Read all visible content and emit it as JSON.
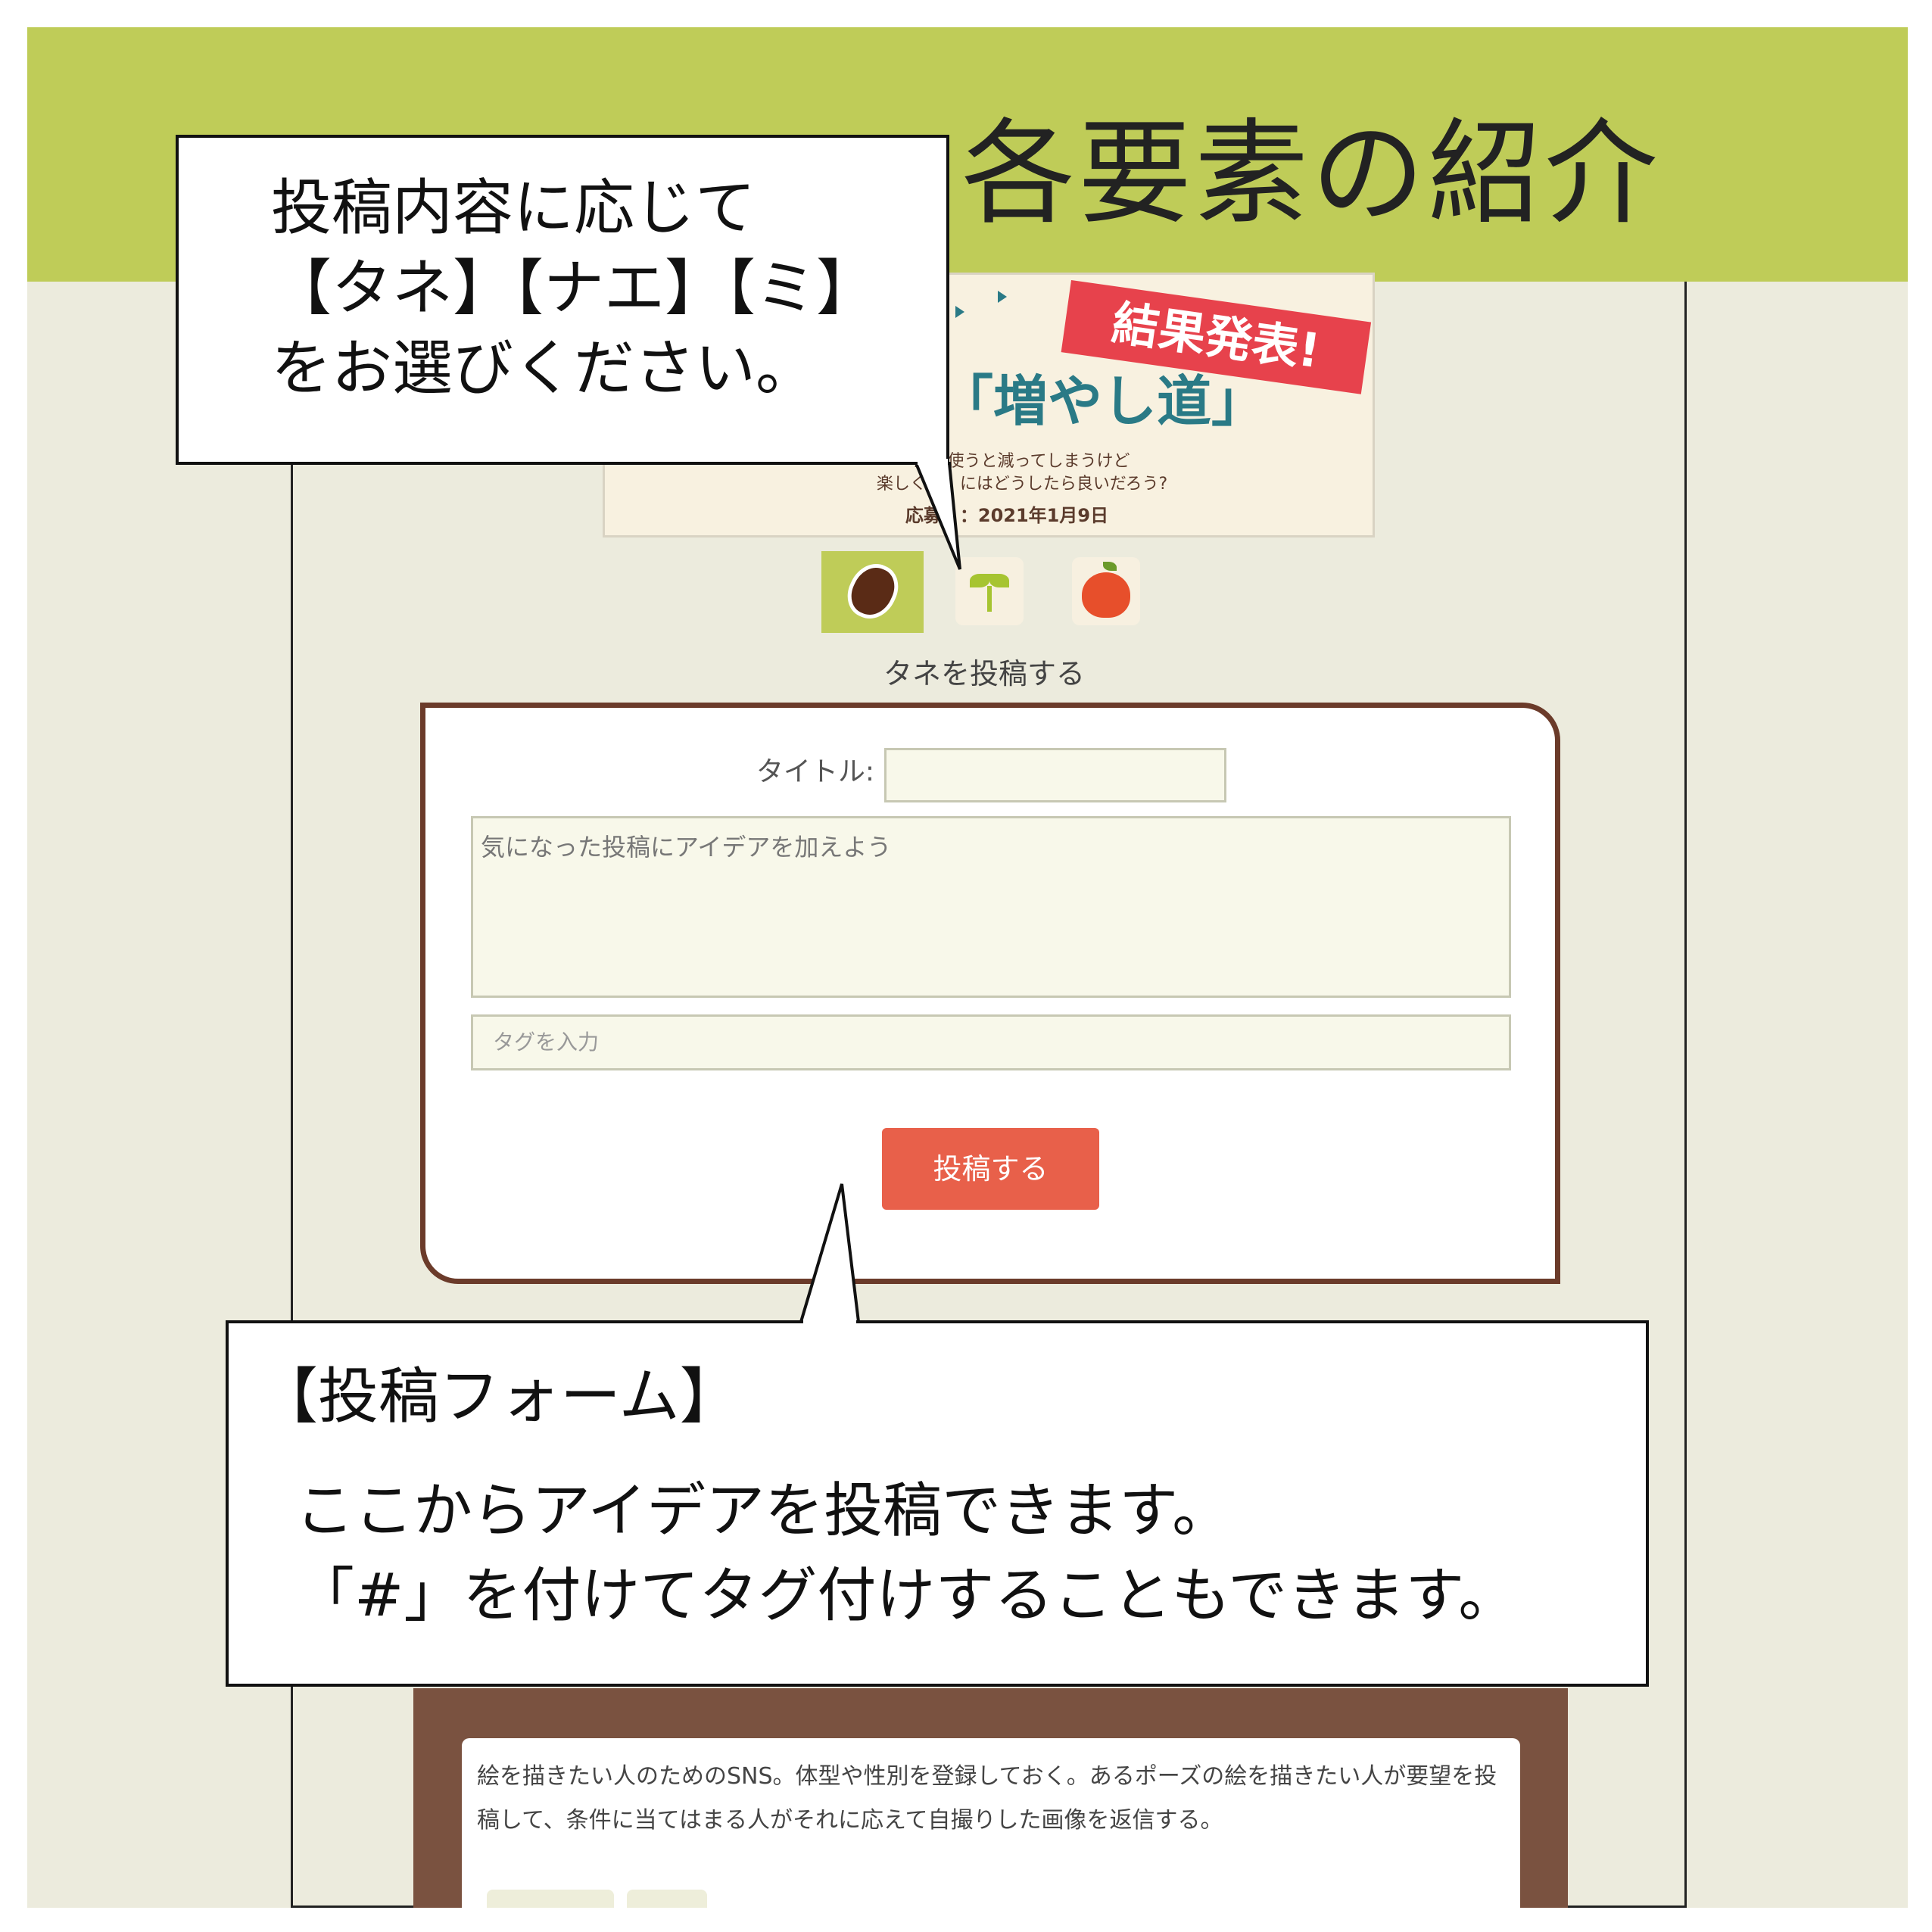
{
  "header": {
    "title": "各要素の紹介"
  },
  "banner": {
    "badge": "結果発表!",
    "title": "「増やし道」",
    "subtitle_line1": "玉、使うと減ってしまうけど",
    "subtitle_line2": "楽しく　　にはどうしたら良いだろう?",
    "date": "応募　：2021年1月9日"
  },
  "post_types": [
    {
      "name": "seed-icon",
      "selected": true
    },
    {
      "name": "sprout-icon",
      "selected": false
    },
    {
      "name": "apple-icon",
      "selected": false
    }
  ],
  "form": {
    "heading": "タネを投稿する",
    "title_label": "タイトル:",
    "title_value": "",
    "body_placeholder": "気になった投稿にアイデアを加えよう",
    "tag_placeholder": "タグを入力",
    "submit_label": "投稿する"
  },
  "post_preview": {
    "text": "絵を描きたい人のためのSNS。体型や性別を登録しておく。あるポーズの絵を描きたい人が要望を投稿して、条件に当てはまる人がそれに応えて自撮りした画像を返信する。"
  },
  "callouts": {
    "type_select": "投稿内容に応じて\n【タネ】【ナエ】【ミ】\nをお選びください。",
    "form_title": "【投稿フォーム】",
    "form_desc": "ここからアイデアを投稿できます。\n「#」を付けてタグ付けすることもできます。"
  },
  "colors": {
    "header_bg": "#bfcc58",
    "page_bg": "#ecebdd",
    "form_border": "#6b3b2a",
    "submit_bg": "#e8604a",
    "badge_bg": "#e7424c",
    "title_teal": "#2a7a86"
  }
}
